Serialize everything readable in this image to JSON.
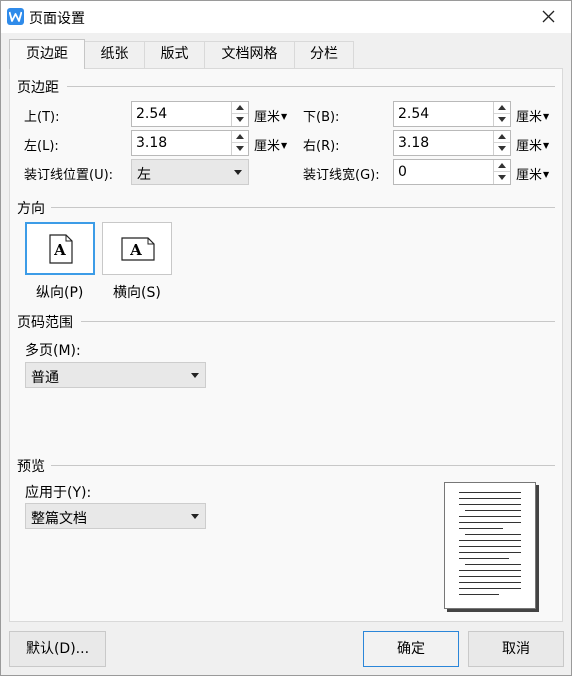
{
  "window": {
    "title": "页面设置"
  },
  "tabs": [
    {
      "label": "页边距"
    },
    {
      "label": "纸张"
    },
    {
      "label": "版式"
    },
    {
      "label": "文档网格"
    },
    {
      "label": "分栏"
    }
  ],
  "margins": {
    "section_title": "页边距",
    "top": {
      "label": "上(T):",
      "value": "2.54",
      "unit": "厘米"
    },
    "bottom": {
      "label": "下(B):",
      "value": "2.54",
      "unit": "厘米"
    },
    "left": {
      "label": "左(L):",
      "value": "3.18",
      "unit": "厘米"
    },
    "right": {
      "label": "右(R):",
      "value": "3.18",
      "unit": "厘米"
    },
    "gutter_position": {
      "label": "装订线位置(U):",
      "value": "左"
    },
    "gutter_width": {
      "label": "装订线宽(G):",
      "value": "0",
      "unit": "厘米"
    }
  },
  "orientation": {
    "section_title": "方向",
    "portrait": {
      "label": "纵向(P)",
      "glyph": "A",
      "selected": true
    },
    "landscape": {
      "label": "横向(S)",
      "glyph": "A"
    }
  },
  "page_range": {
    "section_title": "页码范围",
    "multi_label": "多页(M):",
    "multi_value": "普通"
  },
  "preview": {
    "section_title": "预览",
    "apply_label": "应用于(Y):",
    "apply_value": "整篇文档"
  },
  "buttons": {
    "default": "默认(D)...",
    "ok": "确定",
    "cancel": "取消"
  },
  "colors": {
    "accent": "#3c9ce7",
    "app_icon": "#2f8bea"
  }
}
